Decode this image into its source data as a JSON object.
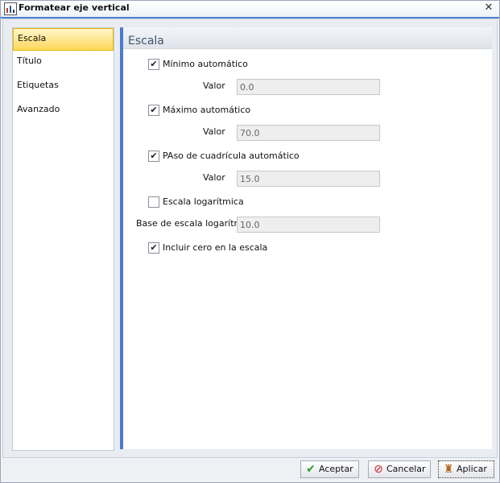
{
  "window": {
    "title": "Formatear eje vertical"
  },
  "nav": {
    "items": [
      {
        "label": "Escala",
        "active": true
      },
      {
        "label": "Título",
        "active": false
      },
      {
        "label": "Etiquetas",
        "active": false
      },
      {
        "label": "Avanzado",
        "active": false
      }
    ]
  },
  "section": {
    "title": "Escala",
    "min_auto": {
      "label": "Mínimo automático",
      "checked": true
    },
    "min_value": {
      "label": "Valor",
      "value": "0.0"
    },
    "max_auto": {
      "label": "Máximo automático",
      "checked": true
    },
    "max_value": {
      "label": "Valor",
      "value": "70.0"
    },
    "step_auto": {
      "label": "PAso de cuadrícula automático",
      "checked": true
    },
    "step_value": {
      "label": "Valor",
      "value": "15.0"
    },
    "log_scale": {
      "label": "Escala logarítmica",
      "checked": false
    },
    "log_base": {
      "label": "Base de escala logarítr",
      "value": "10.0"
    },
    "include_zero": {
      "label": "Incluir cero en la escala",
      "checked": true
    }
  },
  "buttons": {
    "ok": "Aceptar",
    "cancel": "Cancelar",
    "apply": "Aplicar"
  },
  "colors": {
    "accent": "#4a7bd0",
    "active_tab": "#ffd75a"
  }
}
